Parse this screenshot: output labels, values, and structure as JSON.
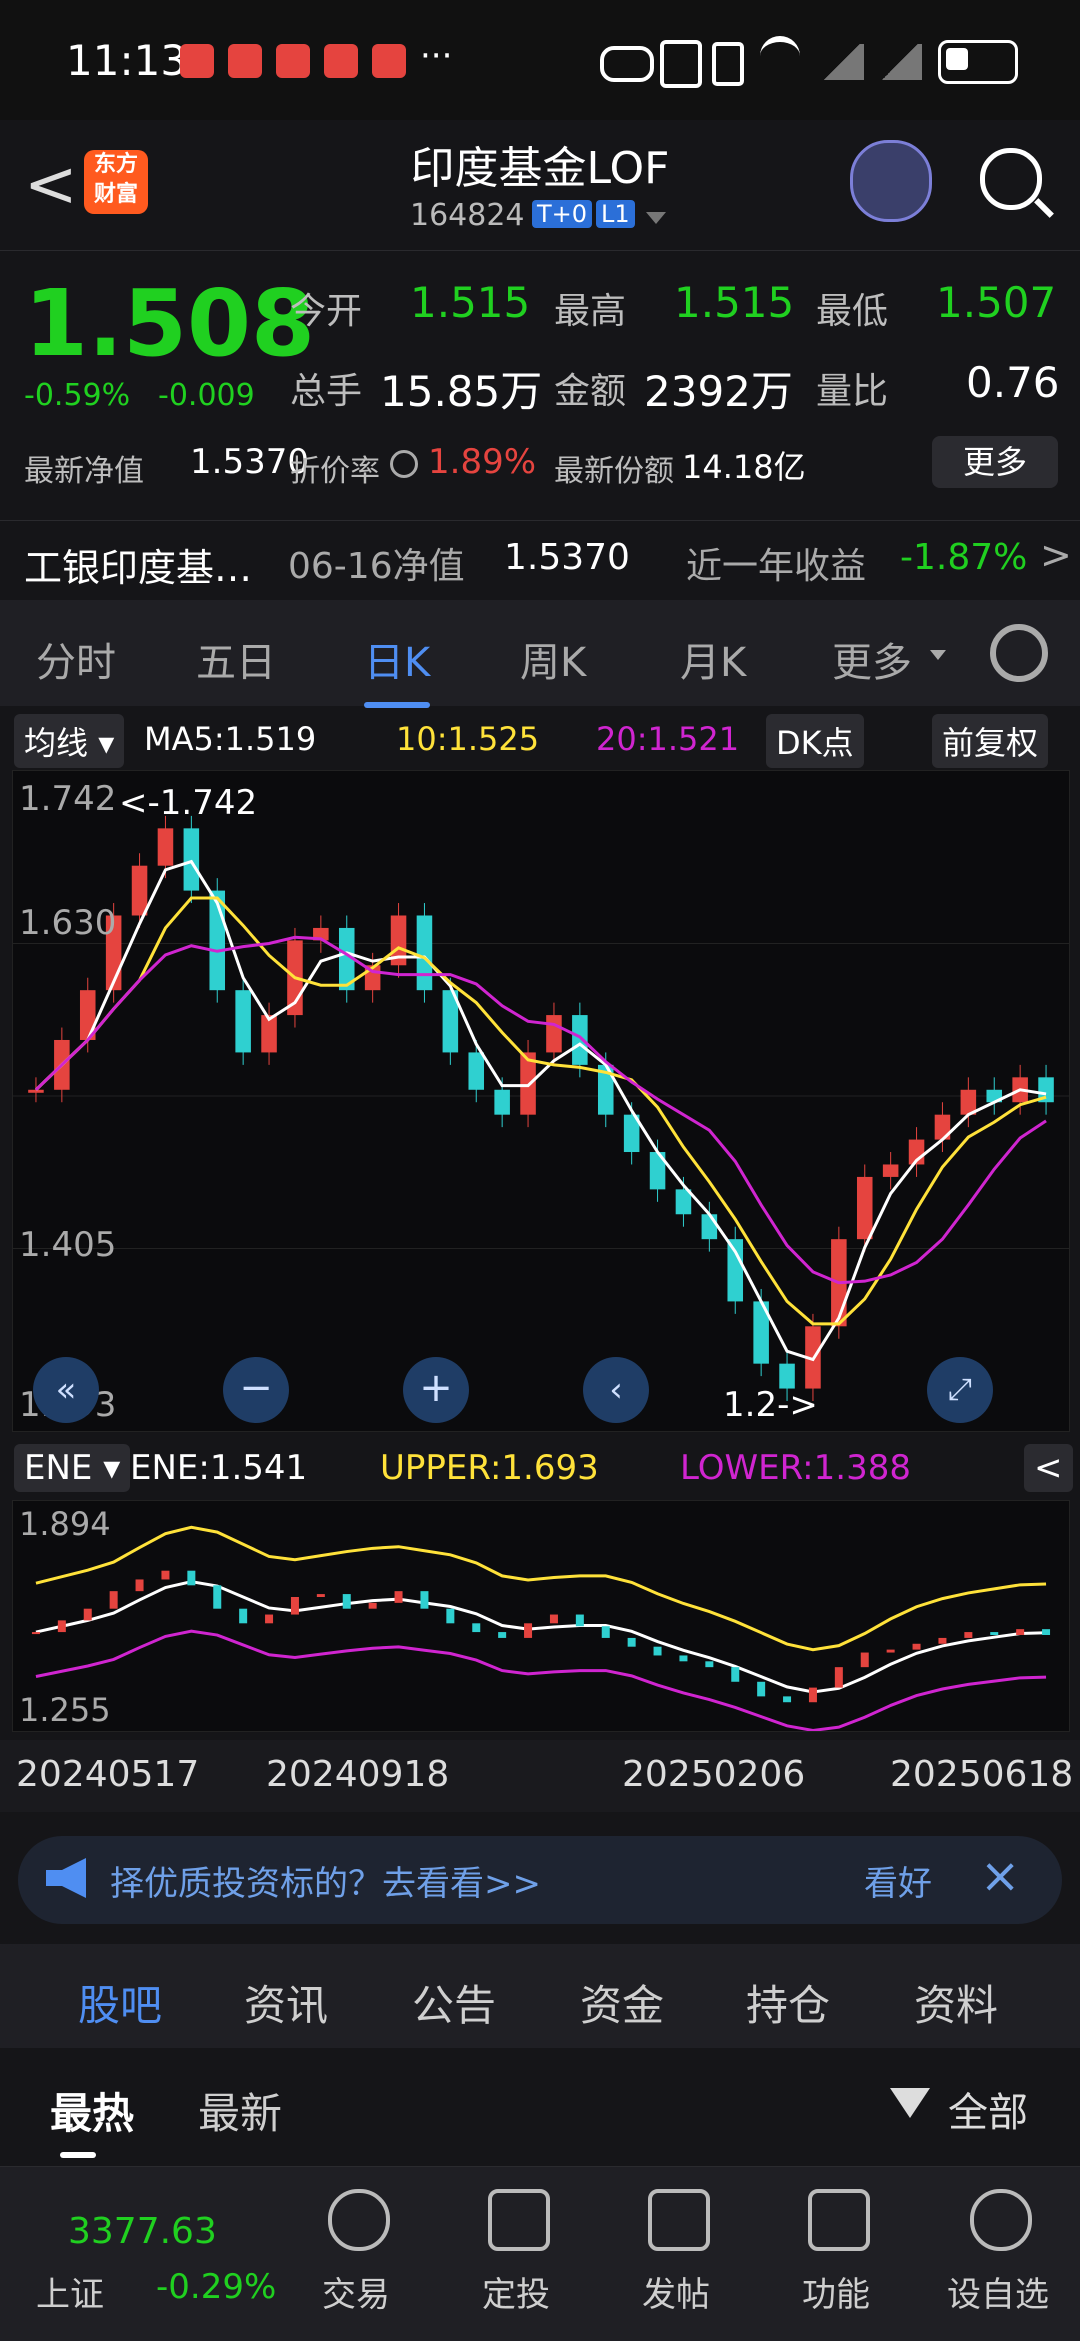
{
  "status_bar": {
    "time": "11:13",
    "dots": "···"
  },
  "header": {
    "back": "<",
    "logo": "东方财富",
    "title": "印度基金LOF",
    "code": "164824",
    "tag1": "T+0",
    "tag2": "L1"
  },
  "quote": {
    "price": "1.508",
    "change_pct": "-0.59%",
    "change": "-0.009",
    "open_label": "今开",
    "open": "1.515",
    "high_label": "最高",
    "high": "1.515",
    "low_label": "最低",
    "low": "1.507",
    "vol_label": "总手",
    "vol": "15.85万",
    "amount_label": "金额",
    "amount": "2392万",
    "ratio_label": "量比",
    "ratio": "0.76",
    "nav_label": "最新净值",
    "nav": "1.5370",
    "discount_label": "折价率",
    "discount": "1.89%",
    "shares_label": "最新份额",
    "shares": "14.18亿",
    "more_label": "更多"
  },
  "fund_row": {
    "name": "工银印度基…",
    "date_label": "06-16净值",
    "nav": "1.5370",
    "yield_label": "近一年收益",
    "yield": "-1.87%"
  },
  "tabs": {
    "t1": "分时",
    "t2": "五日",
    "t3": "日K",
    "t4": "周K",
    "t5": "月K",
    "t6": "更多"
  },
  "ma_row": {
    "toggle": "均线",
    "ma5": "MA5:1.519",
    "ma10": "10:1.525",
    "ma20": "20:1.521",
    "dk": "DK点",
    "adjust": "前复权"
  },
  "chart_data": {
    "type": "candlestick",
    "y_labels": [
      "1.742",
      "1.630",
      "1.405",
      "1.293"
    ],
    "max_marker": "1.742",
    "min_marker": "1.2",
    "x_labels": [
      "20240517",
      "20240918",
      "20250206",
      "20250618"
    ],
    "closes": [
      1.52,
      1.56,
      1.6,
      1.66,
      1.7,
      1.73,
      1.68,
      1.6,
      1.55,
      1.58,
      1.64,
      1.65,
      1.6,
      1.62,
      1.66,
      1.6,
      1.55,
      1.52,
      1.5,
      1.55,
      1.58,
      1.54,
      1.5,
      1.47,
      1.44,
      1.42,
      1.4,
      1.35,
      1.3,
      1.28,
      1.33,
      1.4,
      1.45,
      1.46,
      1.48,
      1.5,
      1.52,
      1.51,
      1.53,
      1.51
    ],
    "colors": {
      "up": "#e5443f",
      "down": "#2fd0d0",
      "ma5": "#ffffff",
      "ma10": "#ffe23a",
      "ma20": "#d025d0",
      "upper": "#ffe23a",
      "lower": "#d025d0"
    }
  },
  "ene_row": {
    "toggle": "ENE",
    "ene": "ENE:1.541",
    "upper": "UPPER:1.693",
    "lower": "LOWER:1.388"
  },
  "ene_axis": {
    "top": "1.894",
    "bottom": "1.255"
  },
  "banner": {
    "text": "择优质投资标的？去看看>>",
    "right": "看好",
    "close": "×"
  },
  "subtabs": {
    "a": "股吧",
    "b": "资讯",
    "c": "公告",
    "d": "资金",
    "e": "持仓",
    "f": "资料"
  },
  "sort": {
    "hot": "最热",
    "new": "最新",
    "filter": "全部"
  },
  "bottom": {
    "index_val": "3377.63",
    "index_name": "上证",
    "index_chg": "-0.29%",
    "n1": "交易",
    "n2": "定投",
    "n3": "发帖",
    "n4": "功能",
    "n5": "设自选"
  }
}
